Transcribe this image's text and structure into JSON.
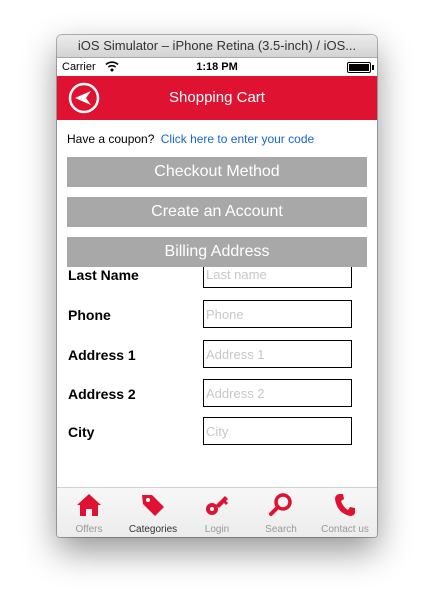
{
  "window": {
    "title": "iOS Simulator – iPhone Retina (3.5-inch) / iOS..."
  },
  "status_bar": {
    "carrier": "Carrier",
    "time": "1:18 PM"
  },
  "nav": {
    "title": "Shopping Cart"
  },
  "coupon": {
    "prompt": "Have a coupon?",
    "link": "Click here to enter your code"
  },
  "sections": {
    "checkout_method": "Checkout Method",
    "create_account": "Create an Account",
    "billing_address": "Billing Address"
  },
  "fields": [
    {
      "label": "Last Name",
      "placeholder": "Last name",
      "value": ""
    },
    {
      "label": "Phone",
      "placeholder": "Phone",
      "value": ""
    },
    {
      "label": "Address 1",
      "placeholder": "Address 1",
      "value": ""
    },
    {
      "label": "Address 2",
      "placeholder": "Address 2",
      "value": ""
    },
    {
      "label": "City",
      "placeholder": "City",
      "value": ""
    }
  ],
  "tabs": [
    {
      "label": "Offers",
      "icon": "home-icon",
      "selected": false
    },
    {
      "label": "Categories",
      "icon": "tag-icon",
      "selected": true
    },
    {
      "label": "Login",
      "icon": "key-icon",
      "selected": false
    },
    {
      "label": "Search",
      "icon": "search-icon",
      "selected": false
    },
    {
      "label": "Contact us",
      "icon": "phone-icon",
      "selected": false
    }
  ],
  "colors": {
    "brand_red": "#df1232",
    "section_gray": "#a8a8a8",
    "link_blue": "#1565d6",
    "tab_inactive": "#999999"
  }
}
